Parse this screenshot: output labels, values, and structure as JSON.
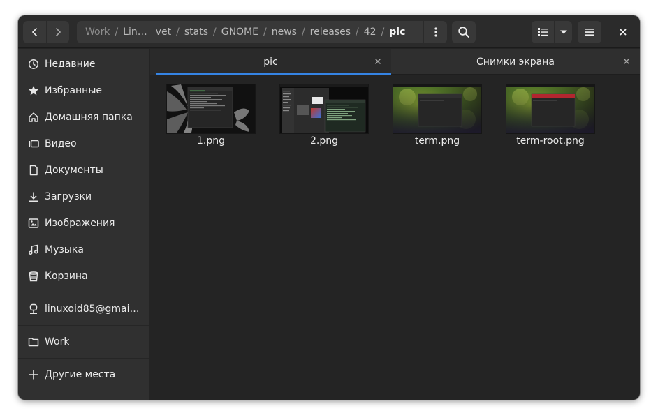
{
  "header": {
    "path": [
      "Work",
      "Lin…",
      "vet",
      "stats",
      "GNOME",
      "news",
      "releases",
      "42",
      "pic"
    ]
  },
  "sidebar": {
    "items": [
      {
        "label": "Недавние",
        "icon": "clock-icon"
      },
      {
        "label": "Избранные",
        "icon": "star-icon"
      },
      {
        "label": "Домашняя папка",
        "icon": "home-icon"
      },
      {
        "label": "Видео",
        "icon": "video-icon"
      },
      {
        "label": "Документы",
        "icon": "document-icon"
      },
      {
        "label": "Загрузки",
        "icon": "download-icon"
      },
      {
        "label": "Изображения",
        "icon": "image-icon"
      },
      {
        "label": "Музыка",
        "icon": "music-icon"
      },
      {
        "label": "Корзина",
        "icon": "trash-icon"
      }
    ],
    "network": {
      "label": "linuxoid85@gmai…",
      "icon": "network-drive-icon"
    },
    "bookmark": {
      "label": "Work",
      "icon": "folder-icon"
    },
    "other": {
      "label": "Другие места",
      "icon": "plus-icon"
    }
  },
  "tabs": [
    {
      "label": "pic",
      "active": true
    },
    {
      "label": "Снимки экрана",
      "active": false
    }
  ],
  "files": [
    {
      "name": "1.png"
    },
    {
      "name": "2.png"
    },
    {
      "name": "term.png"
    },
    {
      "name": "term-root.png"
    }
  ],
  "colors": {
    "accent": "#3584e4",
    "window_bg": "#242424",
    "sidebar_bg": "#303030"
  }
}
